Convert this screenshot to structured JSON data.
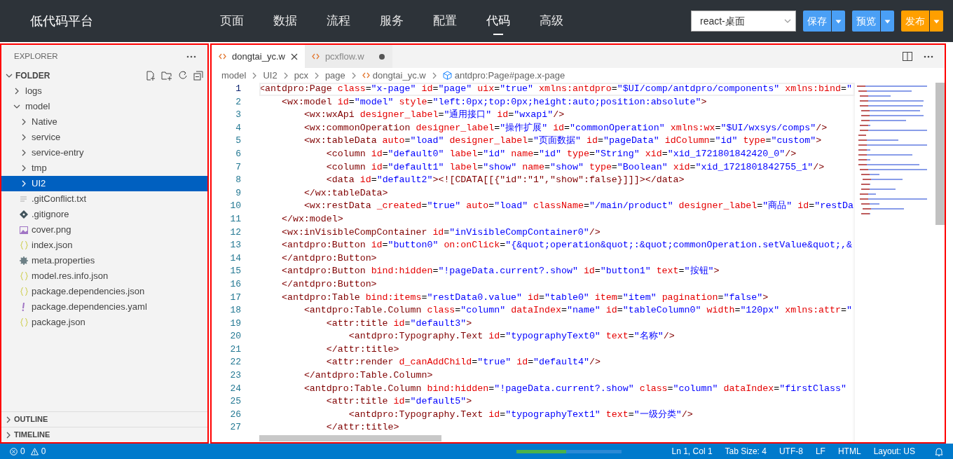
{
  "app": {
    "title": "低代码平台"
  },
  "nav": [
    {
      "label": "页面",
      "selected": false
    },
    {
      "label": "数据",
      "selected": false
    },
    {
      "label": "流程",
      "selected": false
    },
    {
      "label": "服务",
      "selected": false
    },
    {
      "label": "配置",
      "selected": false
    },
    {
      "label": "代码",
      "selected": true
    },
    {
      "label": "高级",
      "selected": false
    }
  ],
  "environment": {
    "value": "react-桌面"
  },
  "actions": [
    {
      "label": "保存",
      "kind": "primary"
    },
    {
      "label": "预览",
      "kind": "primary"
    },
    {
      "label": "发布",
      "kind": "warning"
    }
  ],
  "explorer": {
    "title": "EXPLORER",
    "folder": {
      "label": "FOLDER",
      "expanded": true
    },
    "tree": [
      {
        "label": "logs",
        "kind": "folder",
        "expanded": false,
        "selected": false
      },
      {
        "label": "model",
        "kind": "folder",
        "expanded": true,
        "selected": false,
        "children": [
          {
            "label": "Native",
            "kind": "folder",
            "expanded": false,
            "selected": false
          },
          {
            "label": "service",
            "kind": "folder",
            "expanded": false,
            "selected": false
          },
          {
            "label": "service-entry",
            "kind": "folder",
            "expanded": false,
            "selected": false
          },
          {
            "label": "tmp",
            "kind": "folder",
            "expanded": false,
            "selected": false
          },
          {
            "label": "UI2",
            "kind": "folder",
            "expanded": false,
            "selected": true
          },
          {
            "label": ".gitConflict.txt",
            "kind": "text",
            "selected": false
          },
          {
            "label": ".gitignore",
            "kind": "git",
            "selected": false
          },
          {
            "label": "cover.png",
            "kind": "image",
            "selected": false
          },
          {
            "label": "index.json",
            "kind": "json",
            "selected": false
          },
          {
            "label": "meta.properties",
            "kind": "settings",
            "selected": false
          },
          {
            "label": "model.res.info.json",
            "kind": "json",
            "selected": false
          },
          {
            "label": "package.dependencies.json",
            "kind": "json",
            "selected": false
          },
          {
            "label": "package.dependencies.yaml",
            "kind": "yaml",
            "selected": false
          },
          {
            "label": "package.json",
            "kind": "json",
            "selected": false
          }
        ]
      }
    ],
    "sections": [
      {
        "label": "OUTLINE",
        "expanded": false
      },
      {
        "label": "TIMELINE",
        "expanded": false
      }
    ]
  },
  "editor": {
    "tabs": [
      {
        "label": "dongtai_yc.w",
        "selected": true,
        "modified": false
      },
      {
        "label": "pcxflow.w",
        "selected": false,
        "modified": true
      }
    ],
    "breadcrumb": [
      {
        "label": "model",
        "kind": "folder"
      },
      {
        "label": "UI2",
        "kind": "folder"
      },
      {
        "label": "pcx",
        "kind": "folder"
      },
      {
        "label": "page",
        "kind": "folder"
      },
      {
        "label": "dongtai_yc.w",
        "kind": "file"
      },
      {
        "label": "antdpro:Page#page.x-page",
        "kind": "element"
      }
    ],
    "lines": [
      {
        "number": "1",
        "current": true,
        "code": "<antdpro:Page class=\"x-page\" id=\"page\" uix=\"true\" xmlns:antdpro=\"$UI/comp/antdpro/components\" xmlns:bind=\""
      },
      {
        "number": "2",
        "current": false,
        "code": "    <wx:model id=\"model\" style=\"left:0px;top:0px;height:auto;position:absolute\">"
      },
      {
        "number": "3",
        "current": false,
        "code": "        <wx:wxApi designer_label=\"通用接口\" id=\"wxapi\"/>"
      },
      {
        "number": "4",
        "current": false,
        "code": "        <wx:commonOperation designer_label=\"操作扩展\" id=\"commonOperation\" xmlns:wx=\"$UI/wxsys/comps\"/>"
      },
      {
        "number": "5",
        "current": false,
        "code": "        <wx:tableData auto=\"load\" designer_label=\"页面数据\" id=\"pageData\" idColumn=\"id\" type=\"custom\">"
      },
      {
        "number": "6",
        "current": false,
        "code": "            <column id=\"default0\" label=\"id\" name=\"id\" type=\"String\" xid=\"xid_1721801842420_0\"/>"
      },
      {
        "number": "7",
        "current": false,
        "code": "            <column id=\"default1\" label=\"show\" name=\"show\" type=\"Boolean\" xid=\"xid_1721801842755_1\"/>"
      },
      {
        "number": "8",
        "current": false,
        "code": "            <data id=\"default2\"><![CDATA[[{\"id\":\"1\",\"show\":false}]]]></data>"
      },
      {
        "number": "9",
        "current": false,
        "code": "        </wx:tableData>"
      },
      {
        "number": "10",
        "current": false,
        "code": "        <wx:restData _created=\"true\" auto=\"load\" className=\"/main/product\" designer_label=\"商品\" id=\"restDa"
      },
      {
        "number": "11",
        "current": false,
        "code": "    </wx:model>"
      },
      {
        "number": "12",
        "current": false,
        "code": "    <wx:inVisibleCompContainer id=\"inVisibleCompContainer0\"/>"
      },
      {
        "number": "13",
        "current": false,
        "code": "    <antdpro:Button id=\"button0\" on:onClick=\"{&quot;operation&quot;:&quot;commonOperation.setValue&quot;,&"
      },
      {
        "number": "14",
        "current": false,
        "code": "    </antdpro:Button>"
      },
      {
        "number": "15",
        "current": false,
        "code": "    <antdpro:Button bind:hidden=\"!pageData.current?.show\" id=\"button1\" text=\"按钮\">"
      },
      {
        "number": "16",
        "current": false,
        "code": "    </antdpro:Button>"
      },
      {
        "number": "17",
        "current": false,
        "code": "    <antdpro:Table bind:items=\"restData0.value\" id=\"table0\" item=\"item\" pagination=\"false\">"
      },
      {
        "number": "18",
        "current": false,
        "code": "        <antdpro:Table.Column class=\"column\" dataIndex=\"name\" id=\"tableColumn0\" width=\"120px\" xmlns:attr=\""
      },
      {
        "number": "19",
        "current": false,
        "code": "            <attr:title id=\"default3\">"
      },
      {
        "number": "20",
        "current": false,
        "code": "                <antdpro:Typography.Text id=\"typographyText0\" text=\"名称\"/>"
      },
      {
        "number": "21",
        "current": false,
        "code": "            </attr:title>"
      },
      {
        "number": "22",
        "current": false,
        "code": "            <attr:render d_canAddChild=\"true\" id=\"default4\"/>"
      },
      {
        "number": "23",
        "current": false,
        "code": "        </antdpro:Table.Column>"
      },
      {
        "number": "24",
        "current": false,
        "code": "        <antdpro:Table.Column bind:hidden=\"!pageData.current?.show\" class=\"column\" dataIndex=\"firstClass\""
      },
      {
        "number": "25",
        "current": false,
        "code": "            <attr:title id=\"default5\">"
      },
      {
        "number": "26",
        "current": false,
        "code": "                <antdpro:Typography.Text id=\"typographyText1\" text=\"一级分类\"/>"
      },
      {
        "number": "27",
        "current": false,
        "code": "            </attr:title>"
      }
    ]
  },
  "status_bar": {
    "errors": "0",
    "warnings": "0",
    "progress": {
      "level": 0.47
    },
    "items": [
      "Ln 1, Col 1",
      "Tab Size: 4",
      "UTF-8",
      "LF",
      "HTML",
      "Layout: US"
    ]
  }
}
